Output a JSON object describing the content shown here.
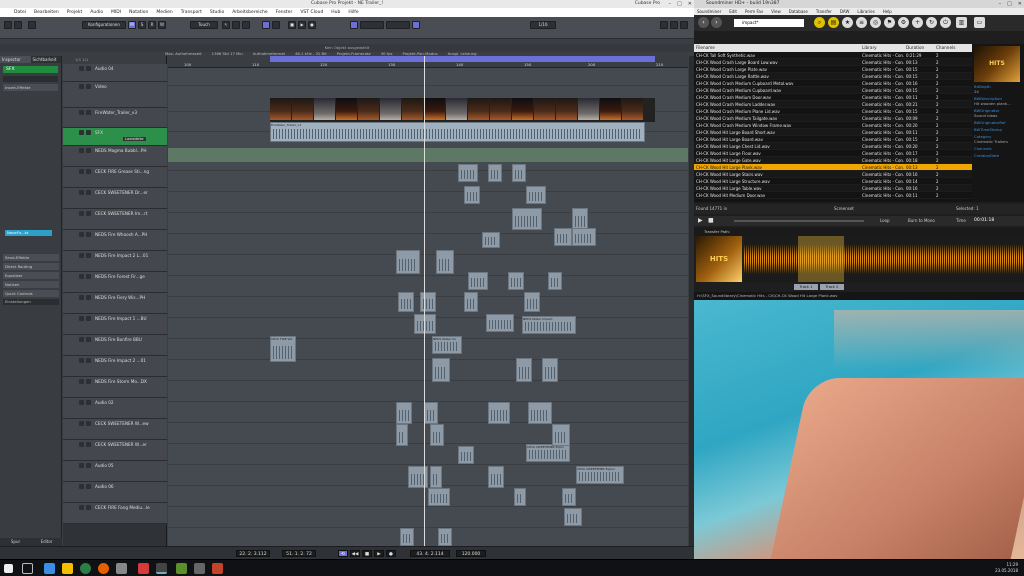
{
  "cubase": {
    "title": "Cubase Pro Projekt - NE Trailer_!",
    "app_name": "Cubase Pro",
    "menu": [
      "Datei",
      "Bearbeiten",
      "Projekt",
      "Audio",
      "MIDI",
      "Notation",
      "Medien",
      "Transport",
      "Studio",
      "Arbeitsbereiche",
      "Fenster",
      "VST Cloud",
      "Hub",
      "Hilfe"
    ],
    "toolbar": {
      "konfig": "Konfigurationen",
      "touch": "Touch",
      "zoom": "1/16"
    },
    "info": [
      "Max. Aufnahmezeit",
      "1366 Std 17 Min",
      "Aufnahmeformat",
      "48.1 kHz - 32 Bit",
      "Projekt-Framerate",
      "30 fps",
      "Projekt-Pan-Modus",
      "Ausgl. Leistung"
    ],
    "status": "Kein Objekt ausgewählt",
    "inspector": {
      "tabs": [
        "Inspector",
        "Sichtbarkeit"
      ],
      "track": "SFX",
      "sections": [
        "Insert-Effekte",
        "Send-Effekte",
        "Direct Routing",
        "Equalizer",
        "Notizen",
        "Quick Controls",
        "Einstellungen"
      ],
      "channel": "NoveFx...tx",
      "bottom": [
        "Spur",
        "Editor"
      ]
    },
    "tracklist_header": "1/1  1/1",
    "tracks": [
      "Audio 04",
      "Video",
      "FireWater_Trailer_v3",
      "SFX",
      "NEDS Magma Bubbl...PH",
      "CECK FIRE Grease Sti...ng",
      "CECK SWEETENER Dr...er",
      "CECK SWEETENER Im...rt",
      "NEDS Fire Whoosh A...PH",
      "NEDS Fire Impact 2 L...01",
      "NEDS Fire Forest Fir...ge",
      "NEDS Fire Fiery Wis...PH",
      "NEDS Fire Impact 1 ...BU",
      "NEDS Fire Bonfire BBU",
      "NEDS Fire Impact 2 ...01",
      "NEDS Fire Storm Mo...DX",
      "Audio 02",
      "CECK SWEETENER W...ew",
      "CECK SWEETENER W...er",
      "Audio 05",
      "Audio 06",
      "CECK FIRE Fang Mediu...le"
    ],
    "sfx_button": "Lautstärke",
    "ruler": [
      "100",
      "110",
      "120",
      "130",
      "140",
      "150",
      "200",
      "210"
    ],
    "clips": {
      "video": "FireWater_Trailer_v3",
      "audio": "FireWater_Trailer_v3",
      "c1": "CECK FIRE WA",
      "c2": "NEDS Water Im",
      "c3": "NEDS Water Impact",
      "c4": "CECK SWEETENER Explo",
      "c5": "CECK SWEETENER Explor"
    },
    "transport": {
      "pos1": "22. 2. 3.112",
      "pos2": "51. 1. 2. 72",
      "pos3": "43. 4. 2.114",
      "tempo": "120.000"
    }
  },
  "soundminer": {
    "title": "Soundminer HD+ - build 19n387",
    "menu": [
      "Soundminer",
      "Edit",
      "Perm Fav",
      "View",
      "Database",
      "Transfer",
      "DAW",
      "Libraries",
      "Help"
    ],
    "search": "impact*",
    "columns": [
      "Filename",
      "Library",
      "Duration",
      "Channels"
    ],
    "rows": [
      [
        "CH-CK Tall Soft Synthetic.wav",
        "Cinematic Hits - Con...",
        "0:21:29",
        "2"
      ],
      [
        "CH-CK Wood Crash Large Board Low.wav",
        "Cinematic Hits - Con...",
        "00:13",
        "2"
      ],
      [
        "CH-CK Wood Crash Large Plate.wav",
        "Cinematic Hits - Con...",
        "00:15",
        "2"
      ],
      [
        "CH-CK Wood Crash Large Rattle.wav",
        "Cinematic Hits - Con...",
        "00:15",
        "2"
      ],
      [
        "CH-CK Wood Crash Medium Cupboard Metal.wav",
        "Cinematic Hits - Con...",
        "00:16",
        "2"
      ],
      [
        "CH-CK Wood Crash Medium Cupboard.wav",
        "Cinematic Hits - Con...",
        "00:15",
        "2"
      ],
      [
        "CH-CK Wood Crash Medium Door.wav",
        "Cinematic Hits - Con...",
        "00:11",
        "2"
      ],
      [
        "CH-CK Wood Crash Medium Ladder.wav",
        "Cinematic Hits - Con...",
        "00:21",
        "2"
      ],
      [
        "CH-CK Wood Crash Medium Plane Lid.wav",
        "Cinematic Hits - Con...",
        "00:15",
        "2"
      ],
      [
        "CH-CK Wood Crash Medium Tailgate.wav",
        "Cinematic Hits - Con...",
        "00:09",
        "2"
      ],
      [
        "CH-CK Wood Crash Medium Window Frame.wav",
        "Cinematic Hits - Con...",
        "00:20",
        "2"
      ],
      [
        "CH-CK Wood Hit Large Board Short.wav",
        "Cinematic Hits - Con...",
        "00:11",
        "2"
      ],
      [
        "CH-CK Wood Hit Large Board.wav",
        "Cinematic Hits - Con...",
        "00:15",
        "2"
      ],
      [
        "CH-CK Wood Hit Large Chest Lid.wav",
        "Cinematic Hits - Con...",
        "00:20",
        "2"
      ],
      [
        "CH-CK Wood Hit Large Floor.wav",
        "Cinematic Hits - Con...",
        "00:17",
        "2"
      ],
      [
        "CH-CK Wood Hit Large Gate.wav",
        "Cinematic Hits - Con...",
        "00:18",
        "2"
      ],
      [
        "CH-CK Wood Hit Large Plank.wav",
        "Cinematic Hits - Con...",
        "00:13",
        "2"
      ],
      [
        "CH-CK Wood Hit Large Stairs.wav",
        "Cinematic Hits - Con...",
        "00:16",
        "2"
      ],
      [
        "CH-CK Wood Hit Large Structure.wav",
        "Cinematic Hits - Con...",
        "00:14",
        "2"
      ],
      [
        "CH-CK Wood Hit Large Table.wav",
        "Cinematic Hits - Con...",
        "00:16",
        "2"
      ],
      [
        "CH-CK Wood Hit Medium Door.wav",
        "Cinematic Hits - Con...",
        "00:11",
        "2"
      ]
    ],
    "selected_index": 16,
    "side": {
      "art": "HITS",
      "k1": "BitDepth",
      "v1": "24",
      "k2": "BWDescription",
      "v2": "Hit wooden plank...",
      "k3": "BWOriginator",
      "v3": "Sound Ideas",
      "k4": "BWOriginatorRef",
      "k5": "BWTimeStamp",
      "k6": "Category",
      "v6": "Cinematic Trailers",
      "k7": "Channels",
      "k8": "CreationDate"
    },
    "found": "Found 14771 in",
    "loop": "Loop",
    "burn": "Burn to Mono",
    "time_label": "Time",
    "time": "00:01:18",
    "screenset": "Screenset",
    "selected": "Selected: 1",
    "transfer_path": "Transfer Path:",
    "tracks": [
      "Track 1",
      "Track 2"
    ],
    "status": "H:\\SFX_Soundlibrary\\Cinematic Hits - CK\\CH-CK Wood Hit Large Plank.wav"
  },
  "taskbar": {
    "time": "11:29",
    "date": "23.05.2018"
  }
}
